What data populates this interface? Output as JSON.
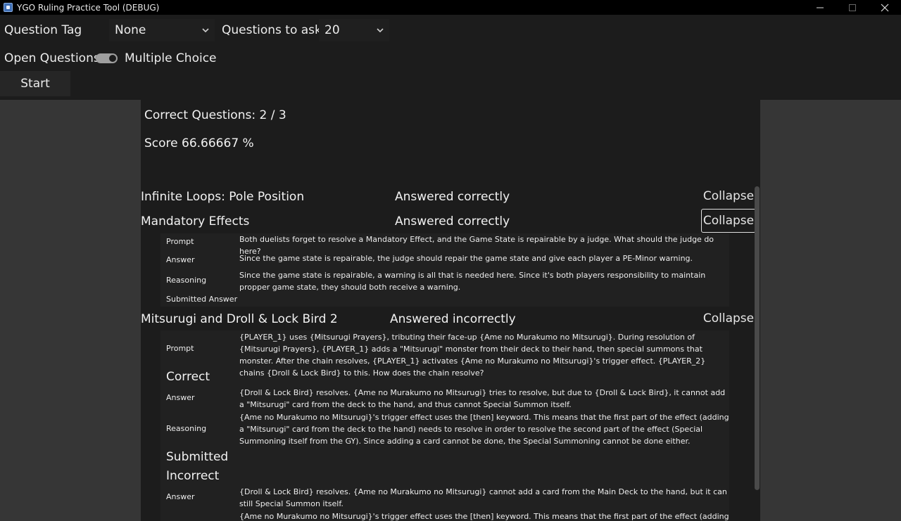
{
  "window": {
    "title": "YGO Ruling Practice Tool (DEBUG)",
    "icons": [
      "minimize-icon",
      "maximize-icon",
      "close-icon"
    ]
  },
  "header": {
    "question_tag_label": "Question Tag",
    "question_tag_value": "None",
    "questions_to_ask_label": "Questions to ask:",
    "questions_to_ask_value": "20",
    "open_questions_label": "Open Questions",
    "multiple_choice_label": "Multiple Choice",
    "start_label": "Start"
  },
  "results": {
    "correct_questions": "Correct Questions: 2 / 3",
    "score": "Score 66.66667 %",
    "questions": [
      {
        "title": "Infinite Loops: Pole Position",
        "status": "Answered correctly",
        "collapse_label": "Collapse"
      },
      {
        "title": "Mandatory Effects",
        "status": "Answered correctly",
        "collapse_label": "Collapse",
        "labels": {
          "prompt": "Prompt",
          "answer": "Answer",
          "reasoning": "Reasoning",
          "submitted": "Submitted Answer"
        },
        "prompt": "Both duelists forget to resolve a Mandatory Effect, and the Game State is repairable by a judge. What should the judge do here?",
        "answer": "Since the game state is repairable, the judge should repair the game state and give each player a PE-Minor warning.",
        "reasoning": "Since the game state is repairable, a warning is all that is needed here. Since it's both players responsibility to maintain propper game state, they should both receive a warning."
      },
      {
        "title": "Mitsurugi and Droll & Lock Bird 2",
        "status": "Answered incorrectly",
        "collapse_label": "Collapse",
        "labels": {
          "prompt": "Prompt",
          "correct": "Correct",
          "answer": "Answer",
          "reasoning": "Reasoning",
          "submitted": "Submitted",
          "incorrect": "Incorrect",
          "answer2": "Answer"
        },
        "prompt": "{PLAYER_1} uses {Mitsurugi Prayers}, tributing their face-up {Ame no Murakumo no Mitsurugi}. During resolution of {Mitsurugi Prayers}, {PLAYER_1} adds a \"Mitsurugi\" monster from their deck to their hand, then special summons that monster. After the chain resolves, {PLAYER_1} activates {Ame no Murakumo no Mitsurugi}'s trigger effect. {PLAYER_2} chains {Droll & Lock Bird} to this. How does the chain resolve?",
        "correct_answer": "{Droll & Lock Bird} resolves. {Ame no Murakumo no Mitsurugi} tries to resolve, but due to {Droll & Lock Bird}, it cannot add a \"Mitsurugi\" card from the deck to the hand, and thus cannot Special Summon itself.",
        "correct_reasoning": "{Ame no Murakumo no Mitsurugi}'s trigger effect uses the [then] keyword. This means that the first part of the effect (adding a \"Mitsurugi\" card from the deck to the hand) needs to resolve in order to resolve the second part of the effect (Special Summoning itself from the GY). Since adding a card cannot be done, the Special Summoning cannot be done either.",
        "incorrect_answer": "{Droll & Lock Bird} resolves. {Ame no Murakumo no Mitsurugi} cannot add a card from the Main Deck to the hand, but it can still Special Summon itself.",
        "incorrect_reasoning_partial": "{Ame no Murakumo no Mitsurugi}'s trigger effect uses the [then] keyword. This means that the first part of the effect (adding a \"Mitsurugi\" card"
      }
    ]
  }
}
